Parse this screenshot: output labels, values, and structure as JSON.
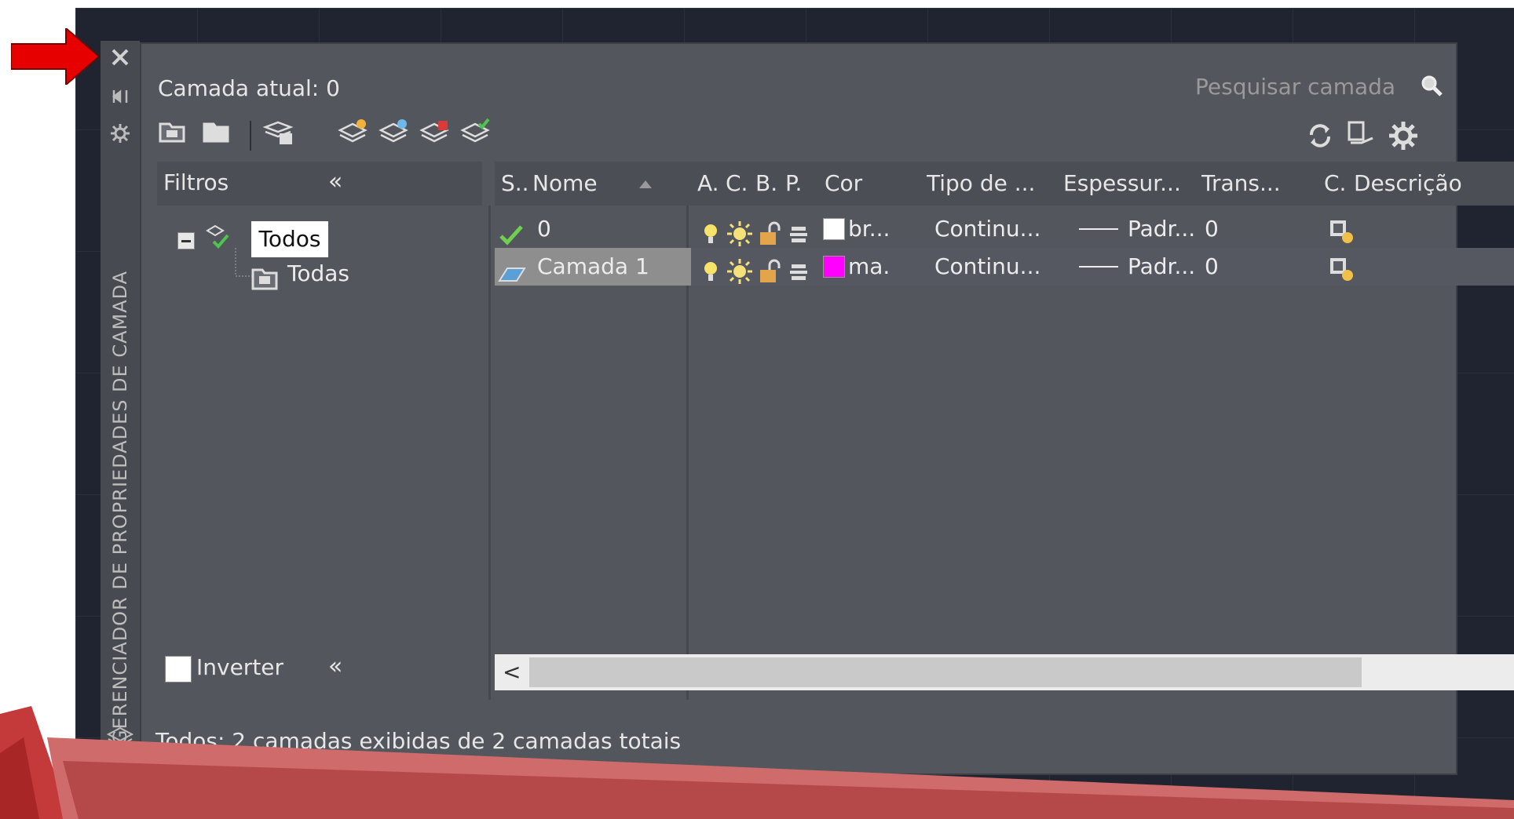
{
  "palette": {
    "accent_red": "#e60000",
    "selected_row": "#8e8e8e",
    "magenta": "#ff00ff"
  },
  "sidebar": {
    "vertical_title": "GERENCIADOR DE PROPRIEDADES DE CAMADA",
    "icons": [
      "close-icon",
      "autohide-icon",
      "properties-icon",
      "layer-stack-icon"
    ]
  },
  "header": {
    "current_layer": "Camada atual: 0",
    "search_placeholder": "Pesquisar camada"
  },
  "toolbar": {
    "left_icons": [
      "new-property-filter-icon",
      "new-group-filter-icon",
      "layer-states-manager-icon",
      "new-layer-icon",
      "new-layer-vp-frozen-icon",
      "delete-layer-icon",
      "set-current-icon"
    ],
    "right_icons": [
      "refresh-icon",
      "layer-settings-icon",
      "gear-icon"
    ]
  },
  "filters": {
    "header": "Filtros",
    "collapse": "«",
    "tree": [
      {
        "label": "Todos",
        "selected": true
      },
      {
        "label": "Todas"
      }
    ],
    "invert_label": "Inverter",
    "invert_collapse": "«"
  },
  "columns": [
    "S..",
    "Nome",
    "A.",
    "C.",
    "B.",
    "P.",
    "Cor",
    "Tipo de ...",
    "Espessur...",
    "Trans...",
    "C.",
    "Descrição"
  ],
  "rows": [
    {
      "status": "current",
      "name": "0",
      "color_swatch": "#ffffff",
      "color_name": "br...",
      "linetype": "Continu...",
      "lineweight": "Padr...",
      "transparency": "0",
      "description": "",
      "selected": false
    },
    {
      "status": "layer",
      "name": "Camada 1",
      "color_swatch": "#ff00ff",
      "color_name": "ma...",
      "linetype": "Continu...",
      "lineweight": "Padr...",
      "transparency": "0",
      "description": "",
      "selected": true
    }
  ],
  "scroll": {
    "left_arrow": "<",
    "right_arrow": ">"
  },
  "status_bar": "Todos: 2 camadas exibidas de 2 camadas totais"
}
